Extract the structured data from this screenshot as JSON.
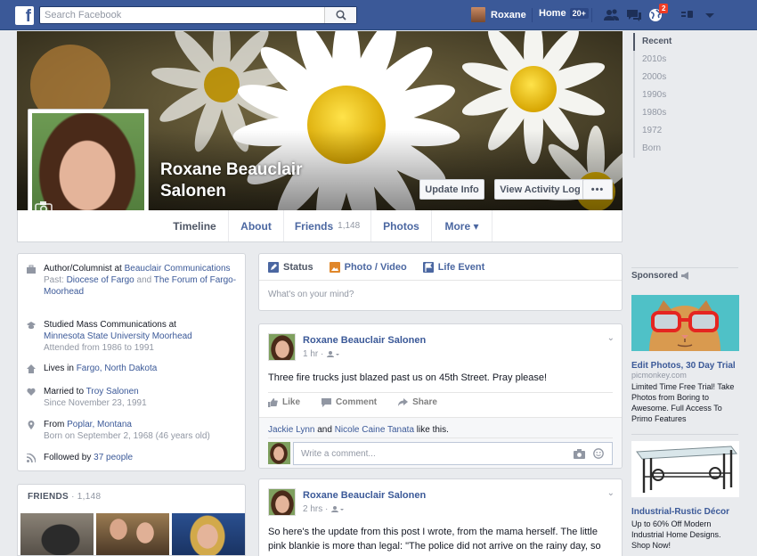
{
  "topbar": {
    "logo": "f",
    "search_placeholder": "Search Facebook",
    "user_name": "Roxane",
    "home_label": "Home",
    "home_count": "20+",
    "notifications_count": "2"
  },
  "profile": {
    "name": "Roxane Beauclair Salonen",
    "update_info": "Update Info",
    "view_activity_log": "View Activity Log",
    "more_dots": "•••"
  },
  "tabs": [
    {
      "label": "Timeline"
    },
    {
      "label": "About"
    },
    {
      "label": "Friends",
      "count": "1,148"
    },
    {
      "label": "Photos"
    },
    {
      "label": "More ▾"
    }
  ],
  "year_nav": [
    "Recent",
    "2010s",
    "2000s",
    "1990s",
    "1980s",
    "1972",
    "Born"
  ],
  "about": {
    "work_prefix": "Author/Columnist at ",
    "work_link": "Beauclair Communications",
    "work_past_prefix": "Past: ",
    "work_past_1": "Diocese of Fargo",
    "work_past_and": " and ",
    "work_past_2": "The Forum of Fargo-Moorhead",
    "study_prefix": "Studied Mass Communications at ",
    "study_link": "Minnesota State University Moorhead",
    "study_sub": "Attended from 1986 to 1991",
    "lives_prefix": "Lives in ",
    "lives_link": "Fargo, North Dakota",
    "married_prefix": "Married to ",
    "married_link": "Troy Salonen",
    "married_sub": "Since November 23, 1991",
    "from_prefix": "From ",
    "from_link": "Poplar, Montana",
    "born_sub": "Born on September 2, 1968 (46 years old)",
    "followed_prefix": "Followed by ",
    "followed_link": "37 people"
  },
  "friends_box": {
    "title": "FRIENDS",
    "count": "· 1,148"
  },
  "composer": {
    "status": "Status",
    "photo_video": "Photo / Video",
    "life_event": "Life Event",
    "placeholder": "What's on your mind?"
  },
  "posts": [
    {
      "author": "Roxane Beauclair Salonen",
      "time": "1 hr ·",
      "text": "Three fire trucks just blazed past us on 45th Street. Pray please!",
      "like": "Like",
      "comment": "Comment",
      "share": "Share",
      "liker_1": "Jackie Lynn",
      "likes_and": " and ",
      "liker_2": "Nicole Caine Tanata",
      "likes_suffix": " like this.",
      "comment_placeholder": "Write a comment..."
    },
    {
      "author": "Roxane Beauclair Salonen",
      "time": "2 hrs ·",
      "text": "So here's the update from this post I wrote, from the mama herself. The little pink blankie is more than legal: \"The police did not arrive on the rainy day, so the"
    }
  ],
  "sponsored": {
    "title": "Sponsored",
    "ads": [
      {
        "title": "Edit Photos, 30 Day Trial",
        "url": "picmonkey.com",
        "body": "Limited Time Free Trial! Take Photos from Boring to Awesome. Full Access To Primo Features"
      },
      {
        "title": "Industrial-Rustic Décor",
        "body": "Up to 60% Off Modern Industrial Home Designs. Shop Now!"
      }
    ]
  },
  "colors": {
    "brand": "#3b5998",
    "link": "#3b5998",
    "badge": "#f03d25"
  }
}
